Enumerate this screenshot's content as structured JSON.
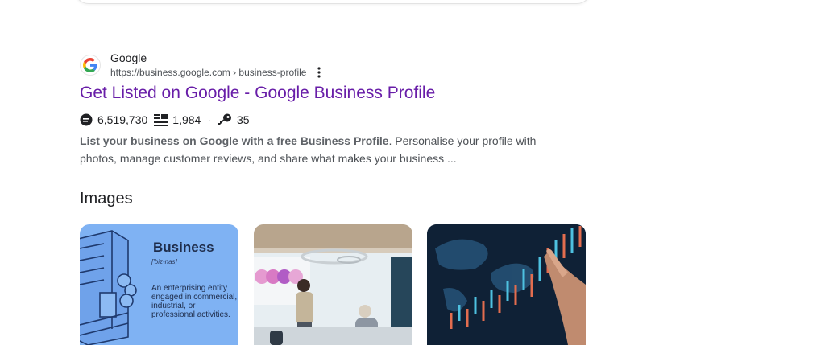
{
  "result": {
    "site_name": "Google",
    "url": "https://business.google.com › business-profile",
    "title": "Get Listed on Google - Google Business Profile",
    "stats": {
      "views": "6,519,730",
      "listings": "1,984",
      "keys": "35",
      "separator": "·"
    },
    "snippet_bold": "List your business on Google with a free Business Profile",
    "snippet_rest": ". Personalise your profile with photos, manage customer reviews, and share what makes your business ..."
  },
  "images_section": {
    "heading": "Images",
    "thumb1": {
      "title": "Business",
      "pronunciation": "['biz-nas]",
      "definition": "An enterprising entity engaged in commercial, industrial, or professional activities."
    }
  },
  "colors": {
    "link_visited": "#681da8",
    "snippet": "#4d5156",
    "thumb1_bg": "#7fb2f3",
    "thumb3_bg": "#0f2136"
  }
}
